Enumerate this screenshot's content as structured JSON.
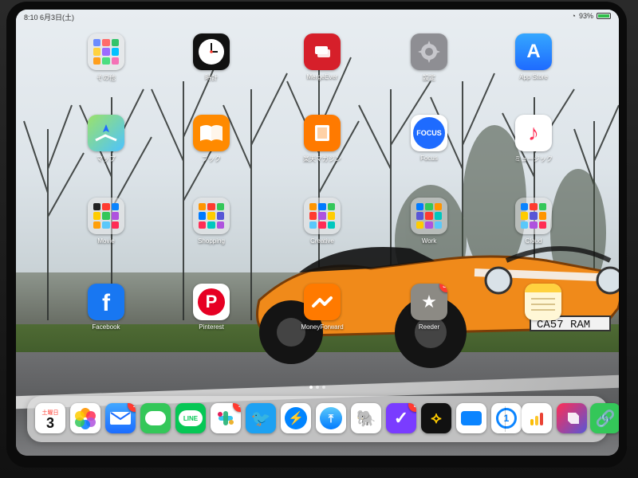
{
  "status_bar": {
    "time": "8:10",
    "date": "6月3日(土)",
    "battery": "93%"
  },
  "apps": {
    "row1": [
      {
        "label": "その他",
        "icon": "folder-icon"
      },
      {
        "label": "時計",
        "icon": "clock-icon"
      },
      {
        "label": "MergeEver",
        "icon": "mergeever-icon"
      },
      {
        "label": "設定",
        "icon": "settings-icon"
      },
      {
        "label": "App Store",
        "icon": "appstore-icon"
      }
    ],
    "row2": [
      {
        "label": "マップ",
        "icon": "maps-icon"
      },
      {
        "label": "ブック",
        "icon": "books-icon"
      },
      {
        "label": "楽天マガジン",
        "icon": "rakuten-magazine-icon"
      },
      {
        "label": "Focus",
        "icon": "focus-icon"
      },
      {
        "label": "ミュージック",
        "icon": "music-icon"
      }
    ],
    "row3": [
      {
        "label": "Movie",
        "icon": "folder-icon"
      },
      {
        "label": "Shopping",
        "icon": "folder-icon"
      },
      {
        "label": "Creative",
        "icon": "folder-icon"
      },
      {
        "label": "Work",
        "icon": "folder-icon"
      },
      {
        "label": "Cloud",
        "icon": "folder-icon"
      }
    ],
    "row4": [
      {
        "label": "Facebook",
        "icon": "facebook-icon"
      },
      {
        "label": "Pinterest",
        "icon": "pinterest-icon"
      },
      {
        "label": "MoneyForward",
        "icon": "moneyforward-icon"
      },
      {
        "label": "Reeder",
        "icon": "reeder-icon",
        "badge": "38"
      },
      {
        "label": "",
        "icon": "notes-icon"
      }
    ]
  },
  "dock": {
    "apps": [
      {
        "name": "calendar",
        "text_top": "土曜日",
        "text_main": "3"
      },
      {
        "name": "photos"
      },
      {
        "name": "mail",
        "badge": "1"
      },
      {
        "name": "messages"
      },
      {
        "name": "line",
        "text_main": "LINE"
      },
      {
        "name": "slack",
        "badge": "1"
      },
      {
        "name": "tweetbot"
      },
      {
        "name": "messenger"
      },
      {
        "name": "safari"
      },
      {
        "name": "evernote"
      },
      {
        "name": "omnifocus",
        "badge": "3"
      },
      {
        "name": "tes"
      },
      {
        "name": "files"
      },
      {
        "name": "1password"
      },
      {
        "name": "analytics"
      },
      {
        "name": "shortcuts"
      },
      {
        "name": "link"
      }
    ]
  },
  "colors": {
    "badge": "#ff3b30",
    "dock_bg": "rgba(220,220,220,.75)"
  }
}
